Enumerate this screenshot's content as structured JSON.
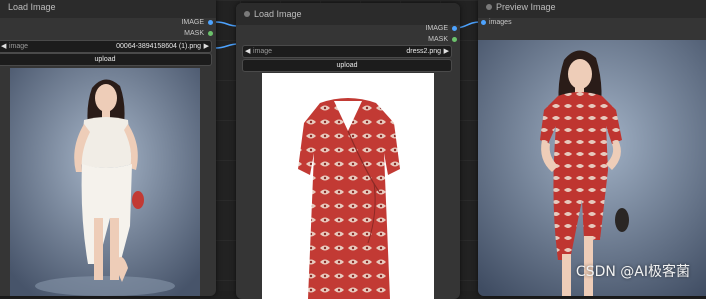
{
  "nodes": {
    "left": {
      "title": "Load Image",
      "outputs": [
        "IMAGE",
        "MASK"
      ],
      "widget_label": "image",
      "widget_value": "00064-3894158604 (1).png",
      "upload_label": "upload",
      "preview_subject": "woman in white dress"
    },
    "middle": {
      "title": "Load Image",
      "outputs": [
        "IMAGE",
        "MASK"
      ],
      "widget_label": "image",
      "widget_value": "dress2.png",
      "upload_label": "upload",
      "preview_subject": "red floral wrap dress"
    },
    "right": {
      "title": "Preview Image",
      "inputs": [
        "images"
      ],
      "preview_subject": "woman in red floral dress"
    }
  },
  "watermark": "CSDN @AI极客菌",
  "colors": {
    "image_slot": "#4da3ff",
    "mask_slot": "#6cc36c",
    "node_bg": "#353535",
    "dress_red": "#c23a34"
  },
  "icons": {
    "arrow_left": "◀",
    "arrow_right": "▶"
  }
}
